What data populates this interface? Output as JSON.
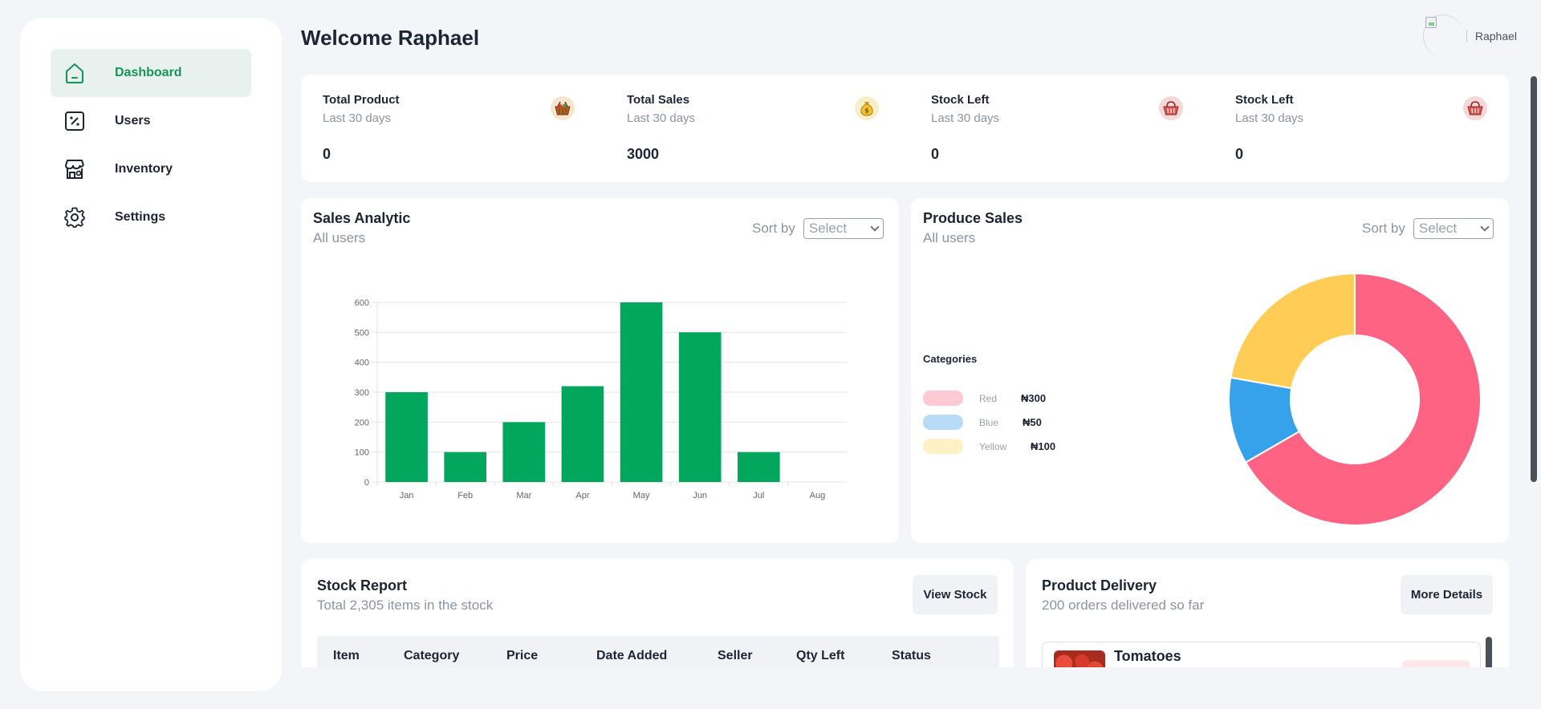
{
  "sidebar": {
    "items": [
      {
        "label": "Dashboard",
        "icon": "home-icon",
        "active": true
      },
      {
        "label": "Users",
        "icon": "percent-doc-icon",
        "active": false
      },
      {
        "label": "Inventory",
        "icon": "store-icon",
        "active": false
      },
      {
        "label": "Settings",
        "icon": "gear-icon",
        "active": false
      }
    ]
  },
  "header": {
    "welcome": "Welcome Raphael",
    "profile_name": "Raphael"
  },
  "stats": [
    {
      "title": "Total Product",
      "subtitle": "Last 30 days",
      "value": "0",
      "icon": "basket-icon"
    },
    {
      "title": "Total Sales",
      "subtitle": "Last 30 days",
      "value": "3000",
      "icon": "money-bag-icon"
    },
    {
      "title": "Stock Left",
      "subtitle": "Last 30 days",
      "value": "0",
      "icon": "basket-icon"
    },
    {
      "title": "Stock Left",
      "subtitle": "Last 30 days",
      "value": "0",
      "icon": "basket-icon"
    }
  ],
  "sales_card": {
    "title": "Sales Analytic",
    "subtitle": "All users",
    "sort_label": "Sort by",
    "select_value": "Select"
  },
  "produce_card": {
    "title": "Produce Sales",
    "subtitle": "All users",
    "sort_label": "Sort by",
    "select_value": "Select",
    "legend_title": "Categories",
    "legend": [
      {
        "name": "Red",
        "value": "₦300",
        "color": "#ffc9d3"
      },
      {
        "name": "Blue",
        "value": "₦50",
        "color": "#b9dcf6"
      },
      {
        "name": "Yellow",
        "value": "₦100",
        "color": "#fff0c6"
      }
    ]
  },
  "stock_card": {
    "title": "Stock Report",
    "subtitle": "Total 2,305 items in the stock",
    "button": "View Stock",
    "columns": [
      "Item",
      "Category",
      "Price",
      "Date Added",
      "Seller",
      "Qty Left",
      "Status"
    ]
  },
  "delivery_card": {
    "title": "Product Delivery",
    "subtitle": "200 orders delivered so far",
    "button": "More Details",
    "items": [
      {
        "name": "Tomatoes"
      }
    ]
  },
  "chart_data": [
    {
      "type": "bar",
      "categories": [
        "Jan",
        "Feb",
        "Mar",
        "Apr",
        "May",
        "Jun",
        "Jul",
        "Aug"
      ],
      "values": [
        300,
        100,
        200,
        320,
        600,
        500,
        100,
        0
      ],
      "ylim": [
        0,
        600
      ],
      "yticks": [
        0,
        100,
        200,
        300,
        400,
        500,
        600
      ],
      "grid": true,
      "color": "#02a65c"
    },
    {
      "type": "pie",
      "donut": true,
      "labels": [
        "Red",
        "Blue",
        "Yellow"
      ],
      "values": [
        300,
        50,
        100
      ],
      "colors": [
        "#ff6384",
        "#36a2eb",
        "#ffcd56"
      ]
    }
  ]
}
